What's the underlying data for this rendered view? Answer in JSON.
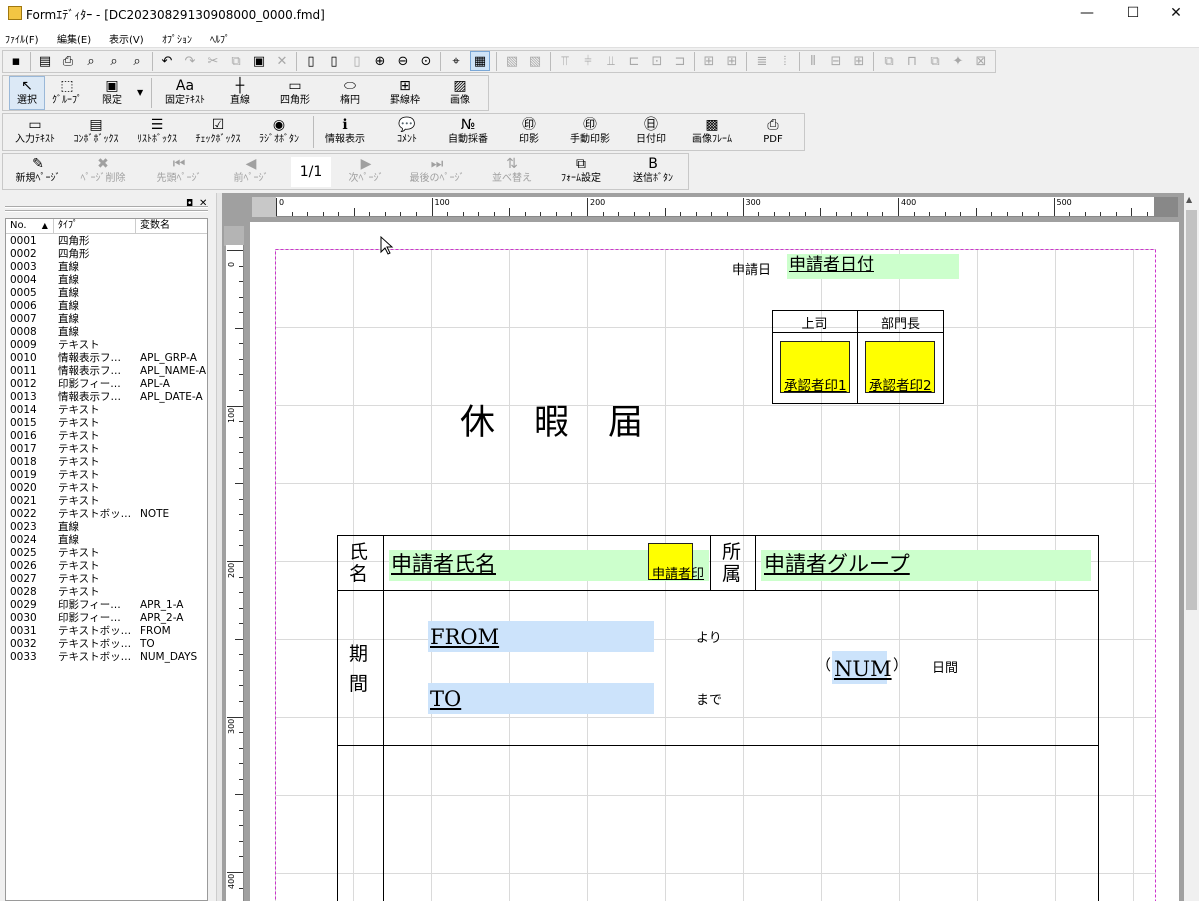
{
  "window": {
    "title": "Formｴﾃﾞｨﾀｰ - [DC20230829130908000_0000.fmd]",
    "min": "—",
    "max": "☐",
    "close": "✕"
  },
  "menu": [
    "ﾌｧｲﾙ(F)",
    "編集(E)",
    "表示(V)",
    "ｵﾌﾟｼｮﾝ",
    "ﾍﾙﾌﾟ"
  ],
  "toolbar2": [
    {
      "icon": "pointer-icon",
      "label": "選択",
      "glyph": "↖"
    },
    {
      "icon": "group-icon",
      "label": "ｸﾞﾙｰﾌﾟ",
      "glyph": "⬚"
    },
    {
      "icon": "limit-icon",
      "label": "限定",
      "glyph": "▣"
    },
    {
      "icon": "fixed-text-icon",
      "label": "固定ﾃｷｽﾄ",
      "glyph": "Aa"
    },
    {
      "icon": "line-icon",
      "label": "直線",
      "glyph": "┼"
    },
    {
      "icon": "rectangle-icon",
      "label": "四角形",
      "glyph": "▭"
    },
    {
      "icon": "ellipse-icon",
      "label": "楕円",
      "glyph": "⬭"
    },
    {
      "icon": "grid-frame-icon",
      "label": "罫線枠",
      "glyph": "⊞"
    },
    {
      "icon": "image-icon",
      "label": "画像",
      "glyph": "▨"
    }
  ],
  "toolbar3": [
    {
      "icon": "input-text-icon",
      "label": "入力ﾃｷｽﾄ",
      "glyph": "▭"
    },
    {
      "icon": "combobox-icon",
      "label": "ｺﾝﾎﾞﾎﾞｯｸｽ",
      "glyph": "▤"
    },
    {
      "icon": "listbox-icon",
      "label": "ﾘｽﾄﾎﾞｯｸｽ",
      "glyph": "☰"
    },
    {
      "icon": "checkbox-icon",
      "label": "ﾁｪｯｸﾎﾞｯｸｽ",
      "glyph": "☑"
    },
    {
      "icon": "radio-button-icon",
      "label": "ﾗｼﾞｵﾎﾞﾀﾝ",
      "glyph": "◉"
    },
    {
      "icon": "info-display-icon",
      "label": "情報表示",
      "glyph": "ℹ"
    },
    {
      "icon": "comment-icon",
      "label": "ｺﾒﾝﾄ",
      "glyph": "💬"
    },
    {
      "icon": "auto-number-icon",
      "label": "自動採番",
      "glyph": "№"
    },
    {
      "icon": "seal-icon",
      "label": "印影",
      "glyph": "㊞"
    },
    {
      "icon": "manual-seal-icon",
      "label": "手動印影",
      "glyph": "㊞"
    },
    {
      "icon": "date-seal-icon",
      "label": "日付印",
      "glyph": "㊐"
    },
    {
      "icon": "image-frame-icon",
      "label": "画像ﾌﾚｰﾑ",
      "glyph": "▩"
    },
    {
      "icon": "pdf-icon",
      "label": "PDF",
      "glyph": "⎙"
    }
  ],
  "toolbar4": [
    {
      "icon": "new-page-icon",
      "label": "新規ﾍﾟｰｼﾞ",
      "glyph": "✎",
      "disabled": false
    },
    {
      "icon": "delete-page-icon",
      "label": "ﾍﾟｰｼﾞ削除",
      "glyph": "✖",
      "disabled": true
    },
    {
      "icon": "first-page-icon",
      "label": "先頭ﾍﾟｰｼﾞ",
      "glyph": "⏮",
      "disabled": true
    },
    {
      "icon": "prev-page-icon",
      "label": "前ﾍﾟｰｼﾞ",
      "glyph": "◀",
      "disabled": true
    },
    {
      "icon": "next-page-icon",
      "label": "次ﾍﾟｰｼﾞ",
      "glyph": "▶",
      "disabled": true
    },
    {
      "icon": "last-page-icon",
      "label": "最後のﾍﾟｰｼﾞ",
      "glyph": "⏭",
      "disabled": true
    },
    {
      "icon": "sort-icon",
      "label": "並べ替え",
      "glyph": "⇅",
      "disabled": true
    },
    {
      "icon": "form-settings-icon",
      "label": "ﾌｫｰﾑ設定",
      "glyph": "⧉",
      "disabled": false
    },
    {
      "icon": "send-button-icon",
      "label": "送信ﾎﾞﾀﾝ",
      "glyph": "B",
      "disabled": false
    }
  ],
  "page_indicator": "1/1",
  "list": {
    "headers": [
      "No.",
      "ﾀｲﾌﾟ",
      "変数名"
    ],
    "rows": [
      [
        "0001",
        "四角形",
        ""
      ],
      [
        "0002",
        "四角形",
        ""
      ],
      [
        "0003",
        "直線",
        ""
      ],
      [
        "0004",
        "直線",
        ""
      ],
      [
        "0005",
        "直線",
        ""
      ],
      [
        "0006",
        "直線",
        ""
      ],
      [
        "0007",
        "直線",
        ""
      ],
      [
        "0008",
        "直線",
        ""
      ],
      [
        "0009",
        "テキスト",
        ""
      ],
      [
        "0010",
        "情報表示フ…",
        "APL_GRP-A"
      ],
      [
        "0011",
        "情報表示フ…",
        "APL_NAME-A"
      ],
      [
        "0012",
        "印影フィー…",
        "APL-A"
      ],
      [
        "0013",
        "情報表示フ…",
        "APL_DATE-A"
      ],
      [
        "0014",
        "テキスト",
        ""
      ],
      [
        "0015",
        "テキスト",
        ""
      ],
      [
        "0016",
        "テキスト",
        ""
      ],
      [
        "0017",
        "テキスト",
        ""
      ],
      [
        "0018",
        "テキスト",
        ""
      ],
      [
        "0019",
        "テキスト",
        ""
      ],
      [
        "0020",
        "テキスト",
        ""
      ],
      [
        "0021",
        "テキスト",
        ""
      ],
      [
        "0022",
        "テキストボッ…",
        "NOTE"
      ],
      [
        "0023",
        "直線",
        ""
      ],
      [
        "0024",
        "直線",
        ""
      ],
      [
        "0025",
        "テキスト",
        ""
      ],
      [
        "0026",
        "テキスト",
        ""
      ],
      [
        "0027",
        "テキスト",
        ""
      ],
      [
        "0028",
        "テキスト",
        ""
      ],
      [
        "0029",
        "印影フィー…",
        "APR_1-A"
      ],
      [
        "0030",
        "印影フィー…",
        "APR_2-A"
      ],
      [
        "0031",
        "テキストボッ…",
        "FROM"
      ],
      [
        "0032",
        "テキストボッ…",
        "TO"
      ],
      [
        "0033",
        "テキストボッ…",
        "NUM_DAYS"
      ]
    ]
  },
  "ruler": {
    "h": [
      "0",
      "100",
      "200",
      "300",
      "400",
      "500"
    ],
    "v": [
      "0",
      "100",
      "200",
      "300",
      "400"
    ]
  },
  "form": {
    "apply_date_label": "申請日",
    "apply_date_field": "申請者日付",
    "boss_label": "上司",
    "dept_head_label": "部門長",
    "approver1": "承認者印1",
    "approver2": "承認者印2",
    "title": "休　暇　届",
    "name_label_1": "氏",
    "name_label_2": "名",
    "name_field": "申請者氏名",
    "applicant_seal": "申請者印",
    "group_label_1": "所",
    "group_label_2": "属",
    "group_field": "申請者グループ",
    "period_label_1": "期",
    "period_label_2": "間",
    "from_field": "FROM",
    "from_suffix": "より",
    "to_field": "TO",
    "to_suffix": "まで",
    "num_open": "（",
    "num_field": "NUM",
    "num_close": "）",
    "num_suffix": "日間"
  },
  "colors": {
    "field_green": "#ccffcc",
    "field_blue": "#cce3fb",
    "seal_yellow": "#ffff00",
    "guide_magenta": "#cc33cc"
  }
}
